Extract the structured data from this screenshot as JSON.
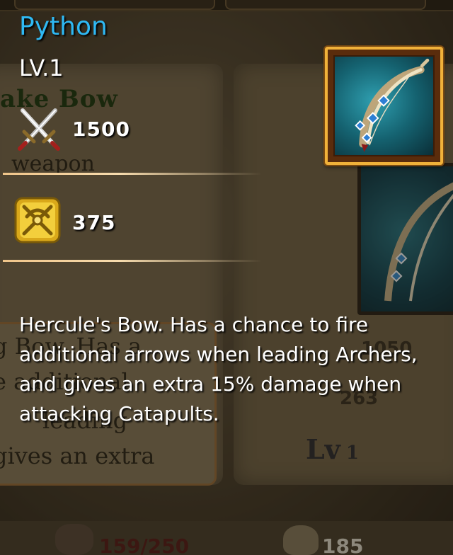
{
  "item": {
    "name": "Python",
    "level": "LV.1",
    "attack": "1500",
    "defense": "375",
    "icon": "bow-icon",
    "description": "Hercule's Bow. Has a chance to fire additional arrows when leading Archers, and gives an extra 15% damage when attacking Catapults."
  },
  "background": {
    "card_title": "ake Bow",
    "card_type": "weapon",
    "desc_lines": [
      "g Bow. Has a",
      "e additional",
      "leading",
      "gives an extra"
    ],
    "stat_a": "1050",
    "stat_b": "263",
    "level_label": "Lv",
    "level_value": "1",
    "resource_ore": "159/250",
    "resource_gold": "185"
  },
  "colors": {
    "title": "#2fb9f4",
    "text": "#ffffff",
    "divider": "#f0c58a",
    "frame_gold": "#f0b13a"
  }
}
